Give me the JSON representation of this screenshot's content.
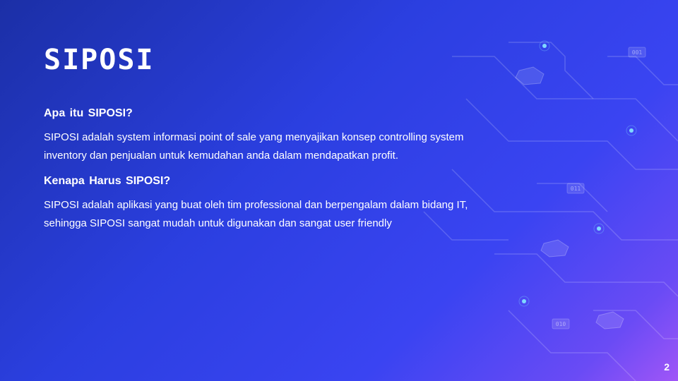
{
  "slide": {
    "title": "SIPOSI",
    "sections": [
      {
        "heading": "Apa itu SIPOSI?",
        "body": "SIPOSI adalah system informasi point of sale yang menyajikan konsep controlling system inventory dan penjualan untuk kemudahan anda dalam mendapatkan profit."
      },
      {
        "heading": "Kenapa Harus SIPOSI?",
        "body": "SIPOSI adalah aplikasi yang buat oleh tim professional dan berpengalam dalam bidang IT, sehingga SIPOSI sangat mudah untuk digunakan dan sangat user friendly"
      }
    ],
    "page_number": "2"
  },
  "decoration": {
    "tags": [
      "001",
      "011",
      "010"
    ]
  },
  "colors": {
    "background_start": "#1b2fa6",
    "background_end": "#a056f7",
    "text": "#ffffff"
  }
}
